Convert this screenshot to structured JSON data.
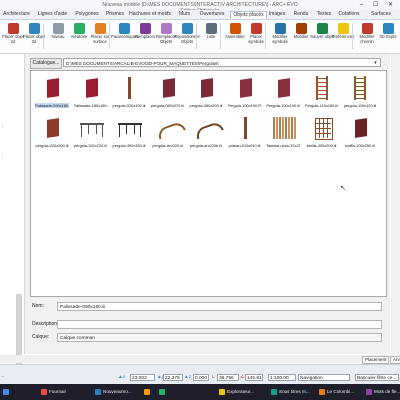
{
  "window": {
    "title": "Nouveau modèle [D:\\MES DOCUMENTS\\INTERACTIV ARCHITECTURE\\] - ARC+ EVO Edition Optimisée",
    "controls": "–  ☐  ✕"
  },
  "menu_tabs": [
    {
      "label": "Architecture",
      "active": false
    },
    {
      "label": "Lignes d'aide",
      "active": false
    },
    {
      "label": "Polygones",
      "active": false
    },
    {
      "label": "Prismes",
      "active": false
    },
    {
      "label": "Hachures et motifs",
      "active": false
    },
    {
      "label": "Murs",
      "active": false
    },
    {
      "label": "Ouvertures",
      "active": false
    },
    {
      "label": "Objets placés",
      "active": true
    },
    {
      "label": "Images",
      "active": false
    },
    {
      "label": "Rendu",
      "active": false
    },
    {
      "label": "Textes",
      "active": false
    },
    {
      "label": "Cotations",
      "active": false
    },
    {
      "label": "Surfaces",
      "active": false
    }
  ],
  "ribbon": [
    {
      "label": "Placer objet 2d",
      "icon": "object-2d-icon",
      "color": "#c0392b"
    },
    {
      "label": "Placer objet 3d",
      "icon": "object-3d-icon",
      "color": "#2e86c1"
    },
    {
      "label": "Niveau",
      "icon": "level-icon",
      "color": "#8e9aa8"
    },
    {
      "label": "Aléatoire",
      "icon": "random-icon",
      "color": "#27ae60"
    },
    {
      "label": "Placer sur surface",
      "icon": "surface-icon",
      "color": "#e67e22"
    },
    {
      "label": "Paramétriques",
      "icon": "parametric-icon",
      "color": "#2e86c1"
    },
    {
      "label": "Remplacer",
      "icon": "replace-icon",
      "color": "#7d3c98"
    },
    {
      "label": "Remplacer Objets",
      "icon": "replace-objects-icon",
      "color": "#af7ac5"
    },
    {
      "label": "Repositionner Objets",
      "icon": "reposition-icon",
      "color": "#2e86c1"
    },
    {
      "label": "Liste",
      "icon": "list-icon",
      "color": "#5d6d7e"
    },
    {
      "label": "Assembler",
      "icon": "assemble-icon",
      "color": "#d35400"
    },
    {
      "label": "Placer symbole",
      "icon": "symbol-icon",
      "color": "#c0392b"
    },
    {
      "label": "Modifier symbole",
      "icon": "edit-symbol-icon",
      "color": "#2874a6"
    },
    {
      "label": "Mobilier",
      "icon": "furniture-icon",
      "color": "#a04000"
    },
    {
      "label": "Sauver objet",
      "icon": "save-object-icon",
      "color": "#1e8449"
    },
    {
      "label": "Préférences",
      "icon": "preferences-icon",
      "color": "#f1c40f"
    },
    {
      "label": "Modifier chemin",
      "icon": "edit-path-icon",
      "color": "#c0392b"
    },
    {
      "label": "3D Explo",
      "icon": "explore-3d-icon",
      "color": "#2e86c1"
    }
  ],
  "left_panel": {
    "marks": [
      ":",
      ":"
    ]
  },
  "catalog": {
    "button_label": "Catalogue...",
    "path": "D:\\MES DOCUMENTS\\ARCALIB-EVO\\3D-POUR_MAQUETTES\\Pergolas\\",
    "items": [
      {
        "label": "Palissade-090x180.iii",
        "kind": "panel",
        "color": "#9b1b30",
        "selected": true
      },
      {
        "label": "Palissade-180x180.iii",
        "kind": "panel",
        "color": "#9b1b30",
        "selected": false
      },
      {
        "label": "pergola-020x190.iii",
        "kind": "post",
        "color": "#7a4a2a",
        "selected": false
      },
      {
        "label": "pergola-050x070.iii",
        "kind": "panel",
        "color": "#7b2a3a",
        "selected": false
      },
      {
        "label": "pergola-080x200.iii",
        "kind": "panel",
        "color": "#7b2a3a",
        "selected": false
      },
      {
        "label": "Pergola-100x190-P.iii",
        "kind": "panel",
        "color": "#8a2f3c",
        "selected": false
      },
      {
        "label": "Pergola-100x190.iii",
        "kind": "panel",
        "color": "#8a2f3c",
        "selected": false
      },
      {
        "label": "Pergola-110x190.iii",
        "kind": "frame",
        "color": "#a0522d",
        "selected": false
      },
      {
        "label": "pergola-110x120.iii",
        "kind": "frame",
        "color": "#8b5a2b",
        "selected": false
      },
      {
        "label": "pergola-220x200.iii",
        "kind": "panel",
        "color": "#8b3a2a",
        "selected": false
      },
      {
        "label": "pergola-320x720.iii",
        "kind": "table",
        "color": "#555555",
        "selected": false
      },
      {
        "label": "pergola-400x330.iii",
        "kind": "table",
        "color": "#333333",
        "selected": false
      },
      {
        "label": "pergola-Arc020.iii",
        "kind": "arc",
        "color": "#8b5a2b",
        "selected": false
      },
      {
        "label": "pergola-arc020b.iii",
        "kind": "arc",
        "color": "#6b4423",
        "selected": false
      },
      {
        "label": "poteau-010x010.iii",
        "kind": "post",
        "color": "#7a4a2a",
        "selected": false
      },
      {
        "label": "Tasseau-bois-37x2T5...",
        "kind": "slats",
        "color": "#b07a4a",
        "selected": false
      },
      {
        "label": "treillis-200x200.iii",
        "kind": "grid",
        "color": "#8b4a2a",
        "selected": false
      },
      {
        "label": "treillis-200x250.iii",
        "kind": "panel",
        "color": "#6b2222",
        "selected": false
      }
    ]
  },
  "form": {
    "name_label": "Nom:",
    "name_value": "Palissade-090x180.iii",
    "description_label": "Description:",
    "description_value": "",
    "layer_label": "Calque:",
    "layer_value": "Calque commun"
  },
  "dialog_buttons": {
    "place": "Placement",
    "cancel": "Annuler"
  },
  "statusbar": {
    "dx": "23.003",
    "dy": "22.378",
    "dz": "0.000",
    "length": "36.756",
    "angle": "145.91",
    "scale": "1:100.00",
    "mode": "Navigation",
    "filter": "Basculer filtre ce...",
    "left_marker": "-"
  },
  "taskbar": {
    "items": [
      {
        "label": "Fournail",
        "color": "#e74c3c"
      },
      {
        "label": "Nouveaumo...",
        "color": "#2980b9"
      },
      {
        "label": "",
        "color": "#f39c12"
      },
      {
        "label": "",
        "color": "#27ae60"
      },
      {
        "label": "Explorateur...",
        "color": "#f1c40f"
      },
      {
        "label": "Sous titres m...",
        "color": "#16a085"
      },
      {
        "label": "Le Colombi...",
        "color": "#e67e22"
      },
      {
        "label": "Mots de fle...",
        "color": "#8e44ad"
      }
    ]
  }
}
